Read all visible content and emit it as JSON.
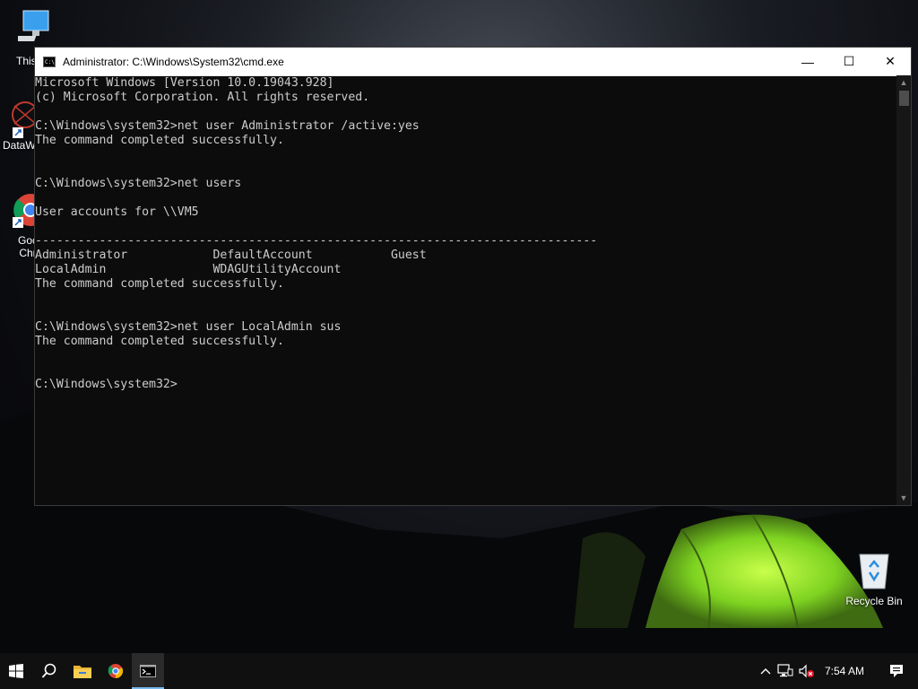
{
  "desktop": {
    "icons": [
      {
        "label": "This",
        "icon": "this-pc-icon"
      },
      {
        "label": "DataW",
        "icon": "datawedge-icon"
      },
      {
        "label": "Goc Chr",
        "icon": "google-chrome-icon"
      },
      {
        "label": "Recycle Bin",
        "icon": "recycle-bin-icon"
      }
    ]
  },
  "window": {
    "title": "Administrator: C:\\Windows\\System32\\cmd.exe",
    "minimize_glyph": "—",
    "maximize_glyph": "☐",
    "close_glyph": "✕"
  },
  "console": {
    "lines": [
      "Microsoft Windows [Version 10.0.19043.928]",
      "(c) Microsoft Corporation. All rights reserved.",
      "",
      "C:\\Windows\\system32>net user Administrator /active:yes",
      "The command completed successfully.",
      "",
      "",
      "C:\\Windows\\system32>net users",
      "",
      "User accounts for \\\\VM5",
      "",
      "-------------------------------------------------------------------------------",
      "Administrator            DefaultAccount           Guest",
      "LocalAdmin               WDAGUtilityAccount",
      "The command completed successfully.",
      "",
      "",
      "C:\\Windows\\system32>net user LocalAdmin sus",
      "The command completed successfully.",
      "",
      "",
      "C:\\Windows\\system32>"
    ]
  },
  "taskbar": {
    "items": [
      "start-icon",
      "search-icon",
      "file-explorer-icon",
      "chrome-icon",
      "cmd-icon"
    ],
    "clock": "7:54 AM"
  }
}
